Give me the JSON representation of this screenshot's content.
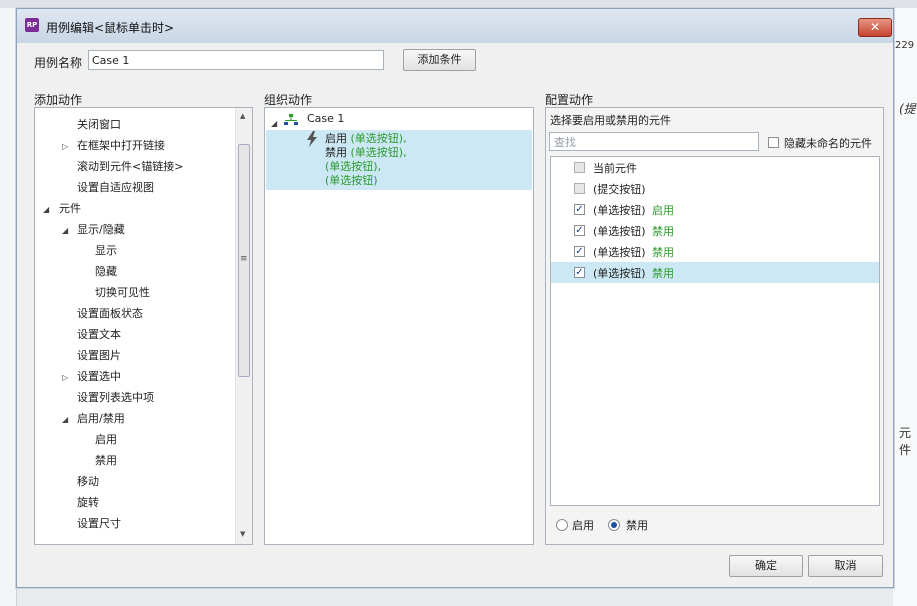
{
  "background": {
    "right_fragments": [
      "229",
      "(提",
      "元件"
    ]
  },
  "dialog": {
    "app_icon": "RP",
    "title": "用例编辑<鼠标单击时>",
    "close_symbol": "✕"
  },
  "case_name": {
    "label": "用例名称",
    "value": "Case 1"
  },
  "add_condition_label": "添加条件",
  "columns": {
    "add_actions": "添加动作",
    "organize_actions": "组织动作",
    "configure_actions": "配置动作"
  },
  "add_actions_tree": [
    {
      "label": "关闭窗口"
    },
    {
      "label": "在框架中打开链接",
      "arrow": "▷"
    },
    {
      "label": "滚动到元件<锚链接>"
    },
    {
      "label": "设置自适应视图"
    },
    {
      "label": "元件",
      "arrow": "◢"
    },
    {
      "label": "显示/隐藏",
      "arrow": "◢"
    },
    {
      "label": "显示"
    },
    {
      "label": "隐藏"
    },
    {
      "label": "切换可见性"
    },
    {
      "label": "设置面板状态"
    },
    {
      "label": "设置文本"
    },
    {
      "label": "设置图片"
    },
    {
      "label": "设置选中",
      "arrow": "▷"
    },
    {
      "label": "设置列表选中项"
    },
    {
      "label": "启用/禁用",
      "arrow": "◢"
    },
    {
      "label": "启用"
    },
    {
      "label": "禁用"
    },
    {
      "label": "移动"
    },
    {
      "label": "旋转"
    },
    {
      "label": "设置尺寸"
    }
  ],
  "organize": {
    "case_label": "Case 1",
    "case_arrow": "◢",
    "lines": [
      {
        "prefix": "启用 ",
        "target": "(单选按钮),"
      },
      {
        "prefix": "禁用 ",
        "target": "(单选按钮),"
      },
      {
        "prefix": "",
        "target": "(单选按钮),"
      },
      {
        "prefix": "",
        "target": "(单选按钮)"
      }
    ]
  },
  "configure": {
    "heading": "选择要启用或禁用的元件",
    "search_placeholder": "查找",
    "hide_unnamed_label": "隐藏未命名的元件",
    "items": [
      {
        "label": "当前元件",
        "action": "",
        "checked": false,
        "disabled": true
      },
      {
        "label": "(提交按钮)",
        "action": "",
        "checked": false,
        "disabled": true
      },
      {
        "label": "(单选按钮)",
        "action": "启用",
        "checked": true,
        "disabled": false
      },
      {
        "label": "(单选按钮)",
        "action": "禁用",
        "checked": true,
        "disabled": false
      },
      {
        "label": "(单选按钮)",
        "action": "禁用",
        "checked": true,
        "disabled": false
      },
      {
        "label": "(单选按钮)",
        "action": "禁用",
        "checked": true,
        "disabled": false,
        "selected": true
      }
    ],
    "radio_enable": "启用",
    "radio_disable": "禁用",
    "selected_radio": "禁用"
  },
  "footer": {
    "ok": "确定",
    "cancel": "取消"
  },
  "colors": {
    "accent_green": "#2c9b2c",
    "selection": "#cde8f5",
    "titlebar": "#c9d6e5"
  }
}
